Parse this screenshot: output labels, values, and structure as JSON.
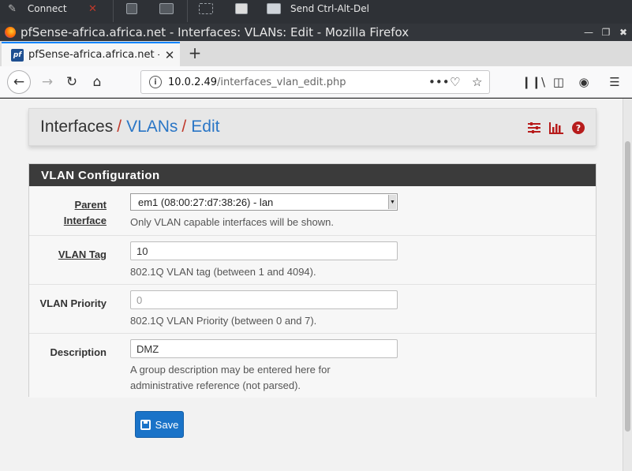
{
  "vnc": {
    "connect_label": "Connect",
    "send_cad_label": "Send Ctrl-Alt-Del"
  },
  "window": {
    "title": "pfSense-africa.africa.net - Interfaces: VLANs: Edit - Mozilla Firefox"
  },
  "tabs": [
    {
      "label": "pfSense-africa.africa.net -",
      "favicon_text": "pf"
    }
  ],
  "urlbar": {
    "host": "10.0.2.49",
    "path": "/interfaces_vlan_edit.php"
  },
  "breadcrumb": {
    "root": "Interfaces",
    "sep": "/",
    "section": "VLANs",
    "current": "Edit"
  },
  "panel": {
    "title": "VLAN Configuration"
  },
  "form": {
    "parent_interface": {
      "label_line1": "Parent",
      "label_line2": "Interface",
      "value": "em1 (08:00:27:d7:38:26) - lan",
      "help": "Only VLAN capable interfaces will be shown."
    },
    "vlan_tag": {
      "label": "VLAN Tag",
      "value": "10",
      "help": "802.1Q VLAN tag (between 1 and 4094)."
    },
    "vlan_priority": {
      "label": "VLAN Priority",
      "placeholder": "0",
      "help": "802.1Q VLAN Priority (between 0 and 7)."
    },
    "description": {
      "label": "Description",
      "value": "DMZ",
      "help_line1": "A group description may be entered here for",
      "help_line2": "administrative reference (not parsed)."
    }
  },
  "actions": {
    "save_label": "Save"
  },
  "colors": {
    "accent_blue": "#1a73c8",
    "breadcrumb_sep": "#c0392b",
    "header_icons": "#b71c1c",
    "panel_heading_bg": "#3b3b3b"
  }
}
